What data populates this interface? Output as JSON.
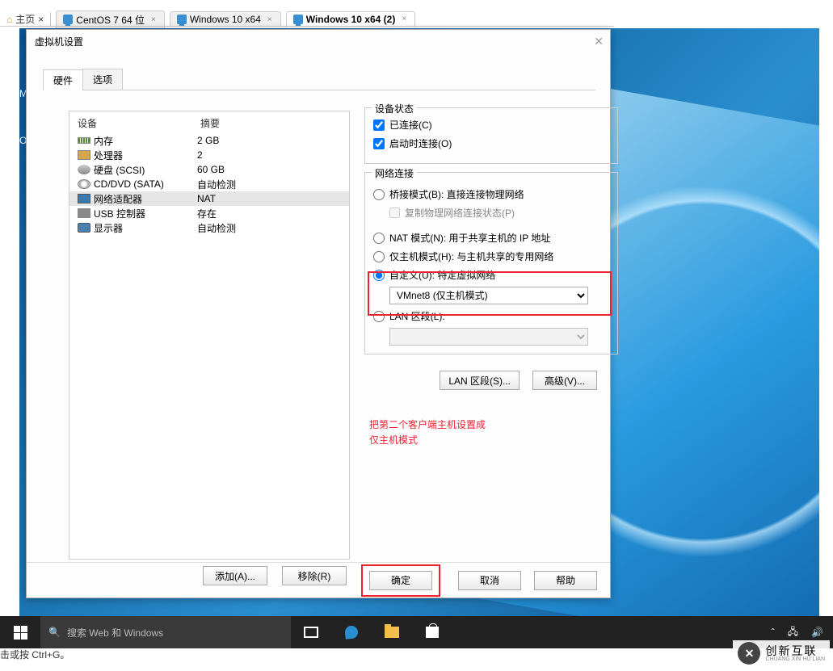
{
  "vmware_tabs": {
    "home": "主页",
    "items": [
      {
        "label": "CentOS 7 64 位",
        "active": false
      },
      {
        "label": "Windows 10 x64",
        "active": false
      },
      {
        "label": "Windows 10 x64 (2)",
        "active": true
      }
    ]
  },
  "dialog": {
    "title": "虚拟机设置",
    "tab_hardware": "硬件",
    "tab_options": "选项"
  },
  "hw_list": {
    "col_device": "设备",
    "col_summary": "摘要",
    "rows": [
      {
        "name": "内存",
        "summary": "2 GB",
        "icon": "memory"
      },
      {
        "name": "处理器",
        "summary": "2",
        "icon": "cpu"
      },
      {
        "name": "硬盘 (SCSI)",
        "summary": "60 GB",
        "icon": "disk"
      },
      {
        "name": "CD/DVD (SATA)",
        "summary": "自动检测",
        "icon": "cd"
      },
      {
        "name": "网络适配器",
        "summary": "NAT",
        "icon": "net",
        "selected": true
      },
      {
        "name": "USB 控制器",
        "summary": "存在",
        "icon": "usb"
      },
      {
        "name": "显示器",
        "summary": "自动检测",
        "icon": "display"
      }
    ]
  },
  "right": {
    "device_state_title": "设备状态",
    "connected": "已连接(C)",
    "connect_on_power": "启动时连接(O)",
    "netconn_title": "网络连接",
    "bridged": "桥接模式(B): 直接连接物理网络",
    "replicate": "复制物理网络连接状态(P)",
    "nat": "NAT 模式(N): 用于共享主机的 IP 地址",
    "hostonly": "仅主机模式(H): 与主机共享的专用网络",
    "custom": "自定义(U): 特定虚拟网络",
    "custom_value": "VMnet8 (仅主机模式)",
    "lan": "LAN 区段(L):",
    "lan_value": "",
    "lan_seg_btn": "LAN 区段(S)...",
    "advanced_btn": "高级(V)..."
  },
  "hw_btns": {
    "add": "添加(A)...",
    "remove": "移除(R)"
  },
  "actions": {
    "ok": "确定",
    "cancel": "取消",
    "help": "帮助"
  },
  "annotation": {
    "line1": "把第二个客户端主机设置成",
    "line2": "仅主机模式"
  },
  "taskbar": {
    "search_placeholder": "搜索 Web 和 Windows"
  },
  "statusline": "击或按 Ctrl+G。",
  "desktop_icons": [
    "",
    "",
    "M",
    "",
    "",
    "OE"
  ],
  "brand": {
    "zh": "创新互联",
    "en": "CHUANG XIN HU LIAN"
  }
}
